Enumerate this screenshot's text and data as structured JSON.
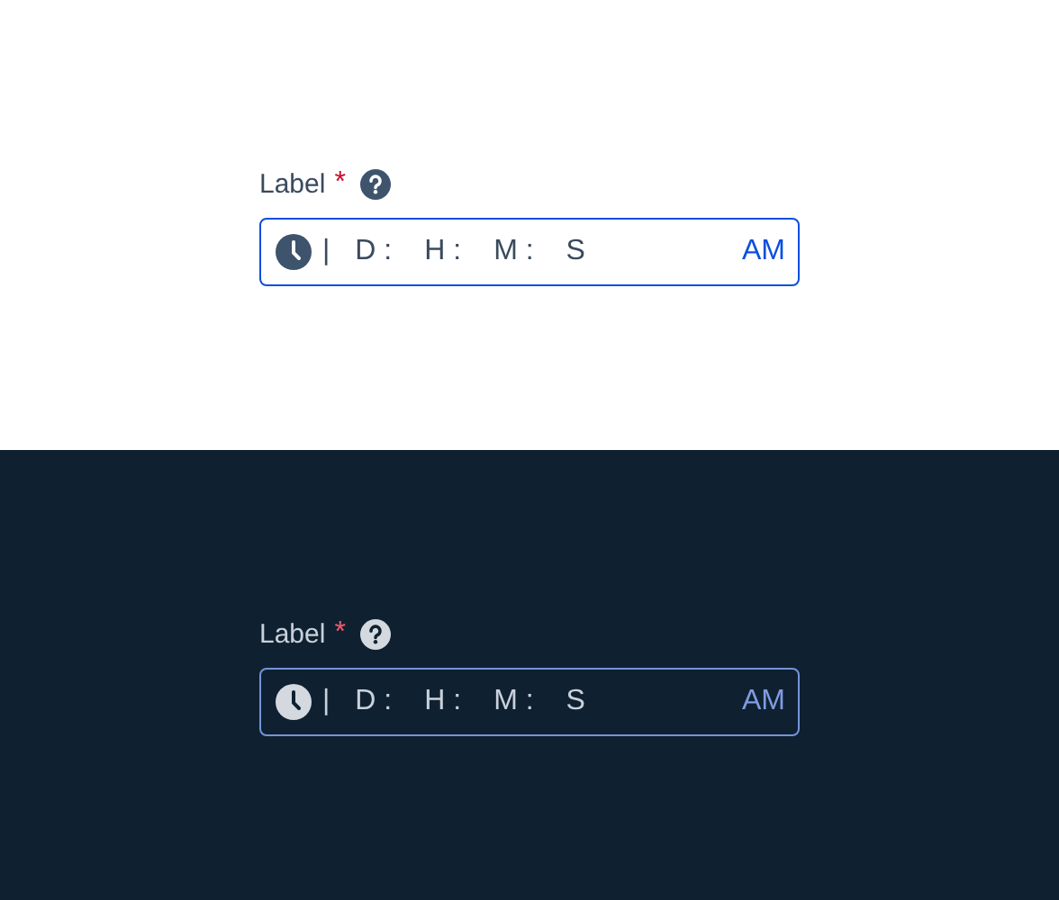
{
  "panels": [
    {
      "kind": "light",
      "label": "Label",
      "required_mark": "*",
      "cursor": "|",
      "segments": [
        "D :",
        "H :",
        "M :",
        "S"
      ],
      "period": "AM"
    },
    {
      "kind": "dark",
      "label": "Label",
      "required_mark": "*",
      "cursor": "|",
      "segments": [
        "D :",
        "H :",
        "M :",
        "S"
      ],
      "period": "AM"
    }
  ]
}
